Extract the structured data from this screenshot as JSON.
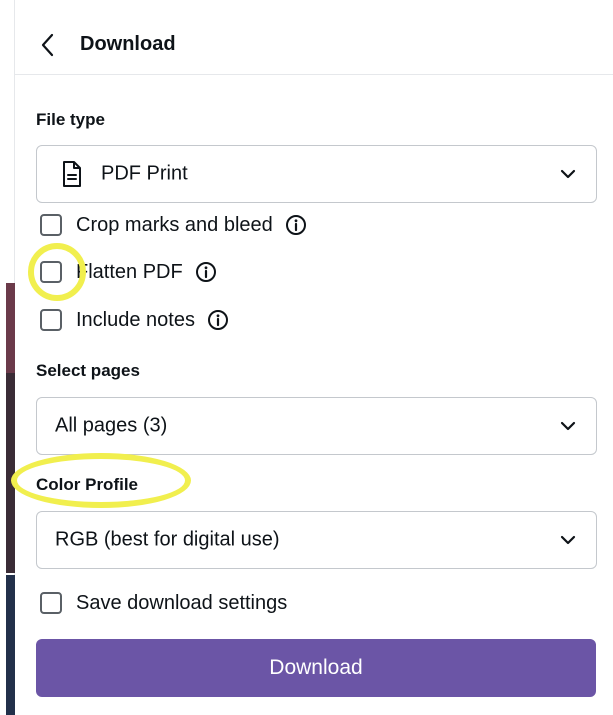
{
  "header": {
    "title": "Download"
  },
  "file_type": {
    "label": "File type",
    "value": "PDF Print"
  },
  "options": {
    "crop_marks": "Crop marks and bleed",
    "flatten_pdf": "Flatten PDF",
    "include_notes": "Include notes"
  },
  "pages": {
    "label": "Select pages",
    "value": "All pages (3)"
  },
  "color_profile": {
    "label": "Color Profile",
    "value": "RGB (best for digital use)"
  },
  "save_settings": {
    "label": "Save download settings"
  },
  "download_button": {
    "label": "Download"
  },
  "colors": {
    "accent": "#6b55a6",
    "highlight": "#f1ef4e"
  }
}
